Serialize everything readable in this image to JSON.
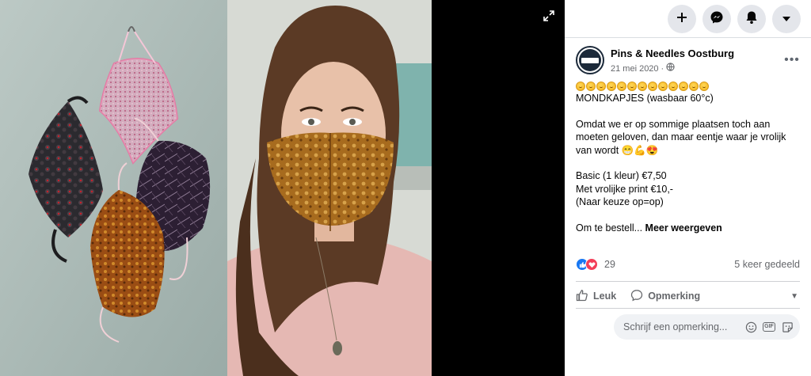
{
  "post": {
    "author": "Pins & Needles Oostburg",
    "date": "21 mei 2020",
    "separator": "·",
    "lines": {
      "title": "MONDKAPJES (wasbaar 60°c)",
      "p1": "Omdat we er op sommige plaatsen toch aan moeten geloven, dan maar eentje waar je vrolijk van wordt",
      "p1_emoji": "😁💪😍",
      "price1": "Basic (1 kleur) €7,50",
      "price2": "Met vrolijke print €10,-",
      "price3": "(Naar keuze op=op)",
      "truncated": "Om te bestell...",
      "see_more": "Meer weergeven"
    },
    "emoji_count": 13
  },
  "stats": {
    "reaction_count": "29",
    "shares": "5 keer gedeeld"
  },
  "actions": {
    "like": "Leuk",
    "comment": "Opmerking"
  },
  "comment_box": {
    "placeholder": "Schrijf een opmerking..."
  },
  "icons": {
    "top": [
      "plus-icon",
      "messenger-icon",
      "notifications-icon",
      "account-caret-icon"
    ],
    "comment": [
      "emoji-icon",
      "gif-icon",
      "sticker-icon"
    ]
  },
  "colors": {
    "accent": "#1877f2",
    "love": "#f33e58",
    "secondary_text": "#65676b",
    "button_bg": "#e4e6eb"
  }
}
